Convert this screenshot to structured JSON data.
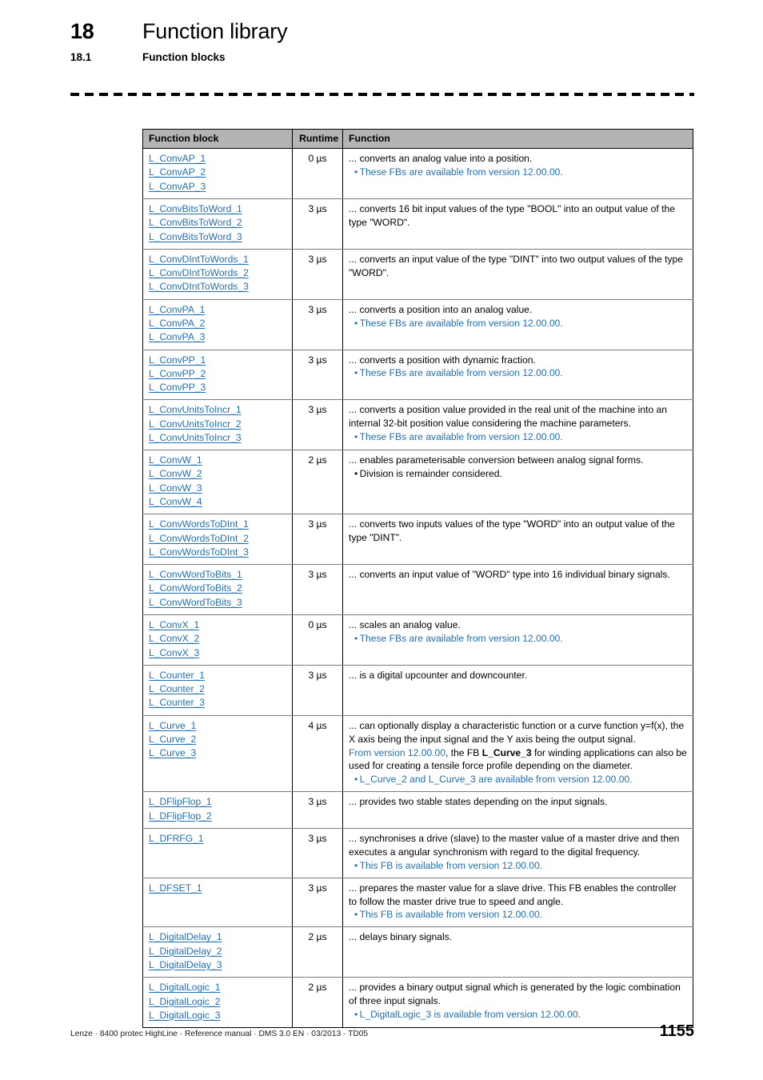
{
  "header": {
    "chapter_number": "18",
    "chapter_title": "Function library",
    "section_number": "18.1",
    "section_title": "Function blocks"
  },
  "table": {
    "columns": [
      "Function block",
      "Runtime",
      "Function"
    ],
    "rows": [
      {
        "blocks": [
          "L_ConvAP_1",
          "L_ConvAP_2",
          "L_ConvAP_3"
        ],
        "runtime": "0 µs",
        "desc": "... converts an analog value into a position.",
        "note": "These FBs are available from version 12.00.00.",
        "note_color": "blue"
      },
      {
        "blocks": [
          "L_ConvBitsToWord_1",
          "L_ConvBitsToWord_2",
          "L_ConvBitsToWord_3"
        ],
        "runtime": "3 µs",
        "desc": "... converts 16 bit input values of the type \"BOOL\" into an output value of the type \"WORD\".",
        "note": "",
        "note_color": ""
      },
      {
        "blocks": [
          "L_ConvDIntToWords_1",
          "L_ConvDIntToWords_2",
          "L_ConvDIntToWords_3"
        ],
        "runtime": "3 µs",
        "desc": "... converts an input value of the type \"DINT\" into two output values of the type \"WORD\".",
        "note": "",
        "note_color": ""
      },
      {
        "blocks": [
          "L_ConvPA_1",
          "L_ConvPA_2",
          "L_ConvPA_3"
        ],
        "runtime": "3 µs",
        "desc": "... converts a position into an analog value.",
        "note": "These FBs are available from version 12.00.00.",
        "note_color": "blue"
      },
      {
        "blocks": [
          "L_ConvPP_1",
          "L_ConvPP_2",
          "L_ConvPP_3"
        ],
        "runtime": "3 µs",
        "desc": "... converts a position with dynamic fraction.",
        "note": "These FBs are available from version 12.00.00.",
        "note_color": "blue"
      },
      {
        "blocks": [
          "L_ConvUnitsToIncr_1",
          "L_ConvUnitsToIncr_2",
          "L_ConvUnitsToIncr_3"
        ],
        "runtime": "3 µs",
        "desc": "... converts a position value provided in the real unit of the machine into an internal 32-bit position value considering the machine parameters.",
        "note": "These FBs are available from version 12.00.00.",
        "note_color": "blue"
      },
      {
        "blocks": [
          "L_ConvW_1",
          "L_ConvW_2",
          "L_ConvW_3",
          "L_ConvW_4"
        ],
        "runtime": "2 µs",
        "desc": "... enables parameterisable conversion between analog signal forms.",
        "note": "Division is remainder considered.",
        "note_color": "black"
      },
      {
        "blocks": [
          "L_ConvWordsToDInt_1",
          "L_ConvWordsToDInt_2",
          "L_ConvWordsToDInt_3"
        ],
        "runtime": "3 µs",
        "desc": "... converts two inputs values of the type \"WORD\" into an output value of the type \"DINT\".",
        "note": "",
        "note_color": ""
      },
      {
        "blocks": [
          "L_ConvWordToBits_1",
          "L_ConvWordToBits_2",
          "L_ConvWordToBits_3"
        ],
        "runtime": "3 µs",
        "desc": "... converts an input value of \"WORD\" type into 16 individual binary signals.",
        "note": "",
        "note_color": ""
      },
      {
        "blocks": [
          "L_ConvX_1",
          "L_ConvX_2",
          "L_ConvX_3"
        ],
        "runtime": "0 µs",
        "desc": "... scales an analog value.",
        "note": "These FBs are available from version 12.00.00.",
        "note_color": "blue"
      },
      {
        "blocks": [
          "L_Counter_1",
          "L_Counter_2",
          "L_Counter_3"
        ],
        "runtime": "3 µs",
        "desc": "... is a digital upcounter and downcounter.",
        "note": "",
        "note_color": ""
      },
      {
        "blocks": [
          "L_Curve_1",
          "L_Curve_2",
          "L_Curve_3"
        ],
        "runtime": "4 µs",
        "desc": "... can optionally display a characteristic function or a curve function y=f(x), the X axis being the input signal and the Y axis being the output signal.",
        "desc2_blue": "From version 12.00.00",
        "desc2_mid": ", the FB ",
        "desc2_bold": "L_Curve_3",
        "desc2_rest": " for winding applications can also be used for creating a tensile force profile depending on the diameter.",
        "note": "L_Curve_2 and L_Curve_3 are available from version 12.00.00.",
        "note_color": "blue"
      },
      {
        "blocks": [
          "L_DFlipFlop_1",
          "L_DFlipFlop_2"
        ],
        "runtime": "3 µs",
        "desc": "... provides two stable states depending on the input signals.",
        "note": "",
        "note_color": ""
      },
      {
        "blocks": [
          "L_DFRFG_1"
        ],
        "runtime": "3 µs",
        "desc": "... synchronises a drive (slave) to the master value of a master drive and then executes a angular synchronism with regard to the digital frequency.",
        "note": "This FB is available from version 12.00.00.",
        "note_color": "blue"
      },
      {
        "blocks": [
          "L_DFSET_1"
        ],
        "runtime": "3 µs",
        "desc": "... prepares the master value for a slave drive. This FB enables the controller to follow the master drive true to speed and angle.",
        "note": "This FB is available from version 12.00.00.",
        "note_color": "blue"
      },
      {
        "blocks": [
          "L_DigitalDelay_1",
          "L_DigitalDelay_2",
          "L_DigitalDelay_3"
        ],
        "runtime": "2 µs",
        "desc": "... delays binary signals.",
        "note": "",
        "note_color": ""
      },
      {
        "blocks": [
          "L_DigitalLogic_1",
          "L_DigitalLogic_2",
          "L_DigitalLogic_3"
        ],
        "runtime": "2 µs",
        "desc": "... provides a binary output signal which is generated by the logic combination of three input signals.",
        "note": "L_DigitalLogic_3 is available from version 12.00.00.",
        "note_color": "blue"
      }
    ]
  },
  "footer": {
    "text": "Lenze · 8400 protec HighLine · Reference manual · DMS 3.0 EN · 03/2013 · TD05",
    "page_number": "1155"
  },
  "colors": {
    "link_blue": "#1f6fb5",
    "header_gray": "#b4b4b4"
  }
}
